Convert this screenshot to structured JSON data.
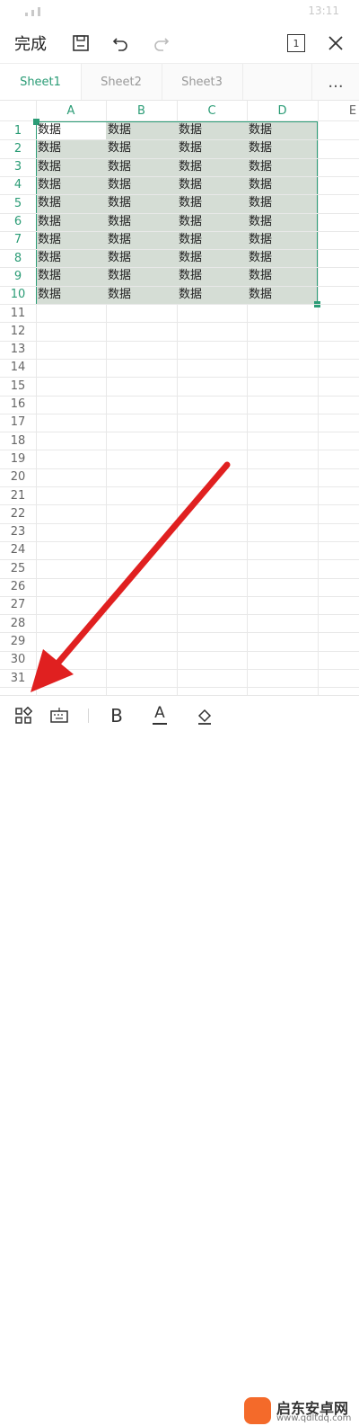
{
  "status": {
    "time": "13:11"
  },
  "toolbar": {
    "done_label": "完成",
    "page_count": "1"
  },
  "tabs": [
    {
      "label": "Sheet1",
      "active": true
    },
    {
      "label": "Sheet2",
      "active": false
    },
    {
      "label": "Sheet3",
      "active": false
    }
  ],
  "tabs_more": "...",
  "columns": [
    "A",
    "B",
    "C",
    "D",
    "E"
  ],
  "rows": [
    "1",
    "2",
    "3",
    "4",
    "5",
    "6",
    "7",
    "8",
    "9",
    "10",
    "11",
    "12",
    "13",
    "14",
    "15",
    "16",
    "17",
    "18",
    "19",
    "20",
    "21",
    "22",
    "23",
    "24",
    "25",
    "26",
    "27",
    "28",
    "29",
    "30",
    "31"
  ],
  "cells": [
    [
      "数据",
      "数据",
      "数据",
      "数据"
    ],
    [
      "数据",
      "数据",
      "数据",
      "数据"
    ],
    [
      "数据",
      "数据",
      "数据",
      "数据"
    ],
    [
      "数据",
      "数据",
      "数据",
      "数据"
    ],
    [
      "数据",
      "数据",
      "数据",
      "数据"
    ],
    [
      "数据",
      "数据",
      "数据",
      "数据"
    ],
    [
      "数据",
      "数据",
      "数据",
      "数据"
    ],
    [
      "数据",
      "数据",
      "数据",
      "数据"
    ],
    [
      "数据",
      "数据",
      "数据",
      "数据"
    ],
    [
      "数据",
      "数据",
      "数据",
      "数据"
    ]
  ],
  "bottom_toolbar": {
    "bold_label": "B",
    "font_color_label": "A"
  },
  "watermark": {
    "title": "启东安卓网",
    "url": "www.qdltdq.com"
  },
  "colors": {
    "accent": "#2b9c76",
    "selection": "#d5ddd5",
    "arrow": "#e02020"
  }
}
